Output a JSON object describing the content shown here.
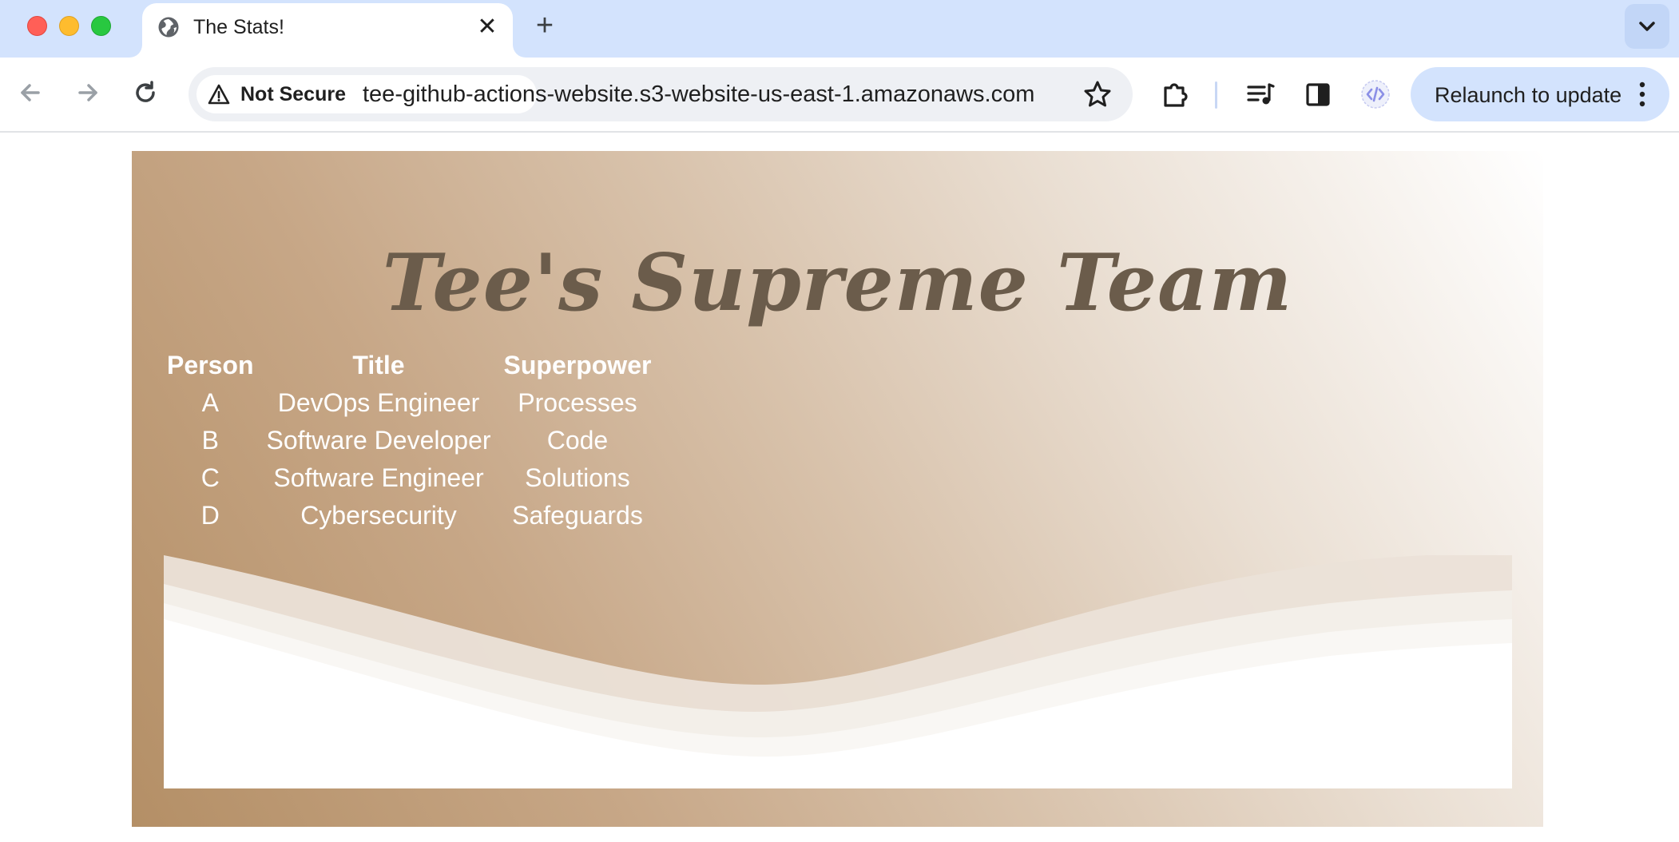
{
  "browser": {
    "tab": {
      "title": "The Stats!",
      "close_glyph": "✕"
    },
    "new_tab_glyph": "+",
    "omnibox": {
      "security_label": "Not Secure",
      "url": "tee-github-actions-website.s3-website-us-east-1.amazonaws.com"
    },
    "relaunch_label": "Relaunch to update",
    "icons": {
      "favicon": "globe-icon",
      "back": "arrow-left-icon",
      "forward": "arrow-right-icon",
      "reload": "reload-icon",
      "warning": "warning-triangle-icon",
      "bookmark": "star-icon",
      "extensions": "puzzle-icon",
      "media": "media-queue-icon",
      "side_panel": "side-panel-icon",
      "devtools": "code-icon",
      "menu": "kebab-menu-icon",
      "tab_search": "chevron-down-icon"
    },
    "colors": {
      "tab_strip": "#d3e3fd",
      "relaunch_button": "#d3e3fd"
    }
  },
  "page": {
    "title": "Tee's Supreme Team",
    "table": {
      "headers": [
        "Person",
        "Title",
        "Superpower"
      ],
      "rows": [
        [
          "A",
          "DevOps Engineer",
          "Processes"
        ],
        [
          "B",
          "Software Developer",
          "Code"
        ],
        [
          "C",
          "Software Engineer",
          "Solutions"
        ],
        [
          "D",
          "Cybersecurity",
          "Safeguards"
        ]
      ]
    },
    "colors": {
      "title": "#6b5c4b",
      "gradient_start": "#b48f66",
      "gradient_end": "#ffffff",
      "table_text": "#ffffff"
    }
  }
}
